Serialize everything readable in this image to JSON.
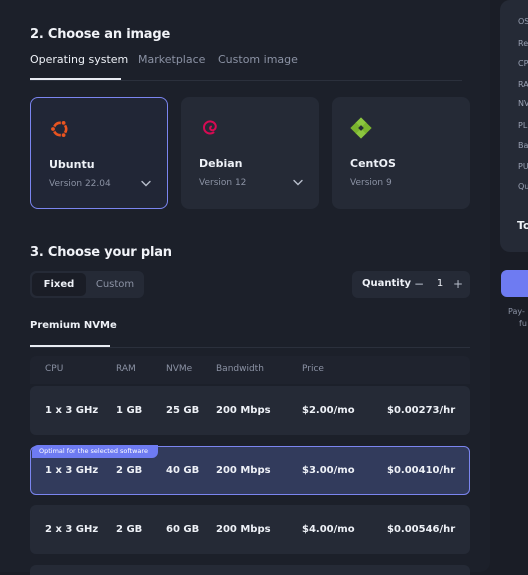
{
  "section_image": {
    "title": "2. Choose an image",
    "tabs": [
      {
        "label": "Operating system",
        "active": true
      },
      {
        "label": "Marketplace",
        "active": false
      },
      {
        "label": "Custom image",
        "active": false
      }
    ],
    "os_cards": [
      {
        "name": "Ubuntu",
        "version": "Version 22.04",
        "icon": "ubuntu-logo-icon",
        "selected": true,
        "has_dropdown": true
      },
      {
        "name": "Debian",
        "version": "Version 12",
        "icon": "debian-logo-icon",
        "selected": false,
        "has_dropdown": true
      },
      {
        "name": "CentOS",
        "version": "Version 9",
        "icon": "centos-logo-icon",
        "selected": false,
        "has_dropdown": false
      }
    ]
  },
  "section_plan": {
    "title": "3. Choose your plan",
    "plan_type": {
      "options": [
        "Fixed",
        "Custom"
      ],
      "selected": "Fixed"
    },
    "quantity": {
      "label": "Quantity",
      "value": "1",
      "minus": "−",
      "plus": "+"
    },
    "subtab": "Premium NVMe",
    "columns": [
      "CPU",
      "RAM",
      "NVMe",
      "Bandwidth",
      "Price"
    ],
    "rows": [
      {
        "cpu": "1 x 3 GHz",
        "ram": "1 GB",
        "nvme": "25 GB",
        "bandwidth": "200 Mbps",
        "price": "$2.00/mo",
        "hourly": "$0.00273/hr",
        "selected": false
      },
      {
        "cpu": "1 x 3 GHz",
        "ram": "2 GB",
        "nvme": "40 GB",
        "bandwidth": "200 Mbps",
        "price": "$3.00/mo",
        "hourly": "$0.00410/hr",
        "selected": true,
        "badge": "Optimal for the selected software"
      },
      {
        "cpu": "2 x 3 GHz",
        "ram": "2 GB",
        "nvme": "60 GB",
        "bandwidth": "200 Mbps",
        "price": "$4.00/mo",
        "hourly": "$0.00546/hr",
        "selected": false
      }
    ]
  },
  "summary_panel": {
    "labels": [
      "OS",
      "Re",
      "CP",
      "RA",
      "NV",
      "PL",
      "Ba",
      "PU",
      "Qu"
    ],
    "total_label": "To",
    "note_lines": [
      "Pay-",
      "fu"
    ]
  },
  "colors": {
    "accent": "#6e7bf2",
    "panel_bg": "#1c202a",
    "card_bg": "#252a36",
    "selected_row_bg": "#323b5c",
    "ubuntu": "#e95420",
    "debian": "#d70a53",
    "centos": "#8cc63f"
  }
}
